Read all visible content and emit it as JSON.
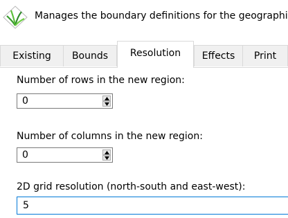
{
  "header": {
    "description": "Manages the boundary definitions for the geographic region",
    "logo_icon": "grass-logo-icon"
  },
  "tabs": [
    {
      "label": "Existing"
    },
    {
      "label": "Bounds"
    },
    {
      "label": "Resolution",
      "active": true
    },
    {
      "label": "Effects"
    },
    {
      "label": "Print"
    }
  ],
  "resolution": {
    "rows_label": "Number of rows in the new region:",
    "rows_value": "0",
    "cols_label": "Number of columns in the new region:",
    "cols_value": "0",
    "grid_label": "2D grid resolution (north-south and east-west):",
    "grid_value": "5"
  },
  "colors": {
    "focus_border": "#0078d7",
    "tab_inactive_bg": "#f0f0f0"
  }
}
